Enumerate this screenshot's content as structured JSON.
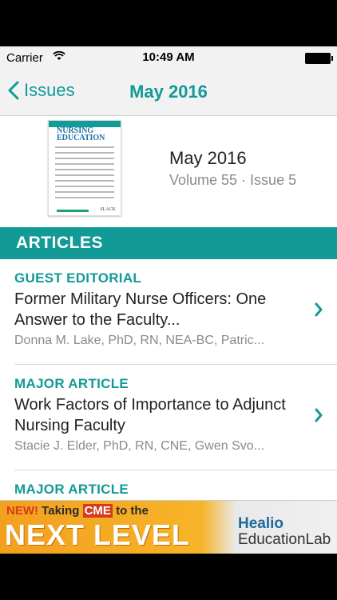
{
  "status": {
    "carrier": "Carrier",
    "time": "10:49 AM"
  },
  "nav": {
    "back_label": "Issues",
    "title": "May 2016"
  },
  "issue": {
    "date": "May 2016",
    "volume": "Volume 55 · Issue 5",
    "cover": {
      "title_line1": "NURSING",
      "title_line2": "EDUCATION",
      "publisher": "SLACK"
    }
  },
  "section": {
    "label": "ARTICLES"
  },
  "articles": [
    {
      "type": "GUEST EDITORIAL",
      "title": "Former Military Nurse Officers: One Answer to the Faculty...",
      "authors": "Donna M. Lake, PhD, RN, NEA-BC, Patric..."
    },
    {
      "type": "MAJOR ARTICLE",
      "title": "Work Factors of Importance to Adjunct Nursing Faculty",
      "authors": "Stacie J. Elder, PhD, RN, CNE, Gwen Svo..."
    },
    {
      "type": "MAJOR ARTICLE",
      "title": "",
      "authors": ""
    }
  ],
  "ad": {
    "line1_new": "NEW!",
    "line1_a": "Taking",
    "line1_b": "CME",
    "line1_c": "to the",
    "line2": "NEXT LEVEL",
    "brand1": "Healio",
    "brand2": "EducationLab"
  },
  "colors": {
    "accent": "#129a96"
  }
}
